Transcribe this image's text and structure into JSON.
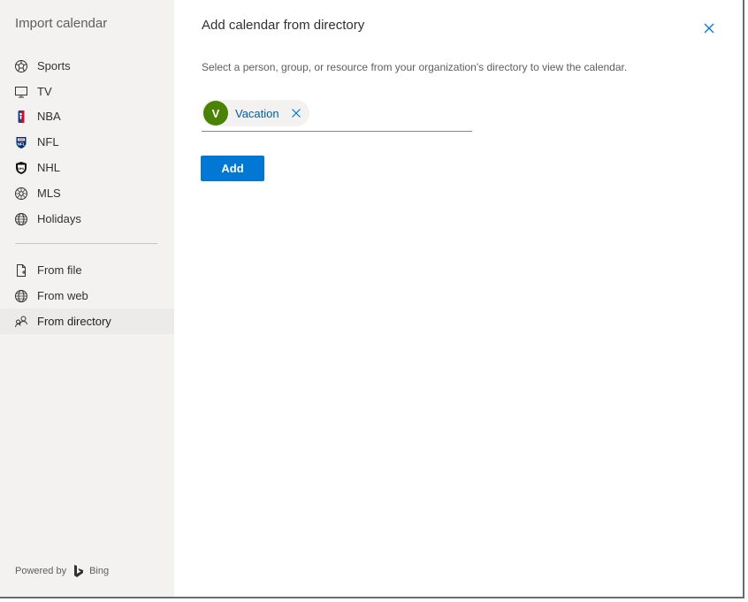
{
  "sidebar": {
    "title": "Import calendar",
    "sports": [
      {
        "label": "Sports",
        "icon": "soccer-ball-icon"
      },
      {
        "label": "TV",
        "icon": "tv-icon"
      },
      {
        "label": "NBA",
        "icon": "nba-logo-icon"
      },
      {
        "label": "NFL",
        "icon": "nfl-logo-icon"
      },
      {
        "label": "NHL",
        "icon": "nhl-logo-icon"
      },
      {
        "label": "MLS",
        "icon": "mls-ball-icon"
      },
      {
        "label": "Holidays",
        "icon": "globe-icon"
      }
    ],
    "sources": [
      {
        "label": "From file",
        "icon": "file-add-icon"
      },
      {
        "label": "From web",
        "icon": "globe-icon"
      },
      {
        "label": "From directory",
        "icon": "people-icon",
        "selected": true
      }
    ],
    "powered_by": "Powered by",
    "bing": "Bing"
  },
  "main": {
    "title": "Add calendar from directory",
    "description": "Select a person, group, or resource from your organization's directory to view the calendar.",
    "selected_persona": {
      "initial": "V",
      "name": "Vacation",
      "color": "#498205"
    },
    "add_button": "Add"
  },
  "colors": {
    "accent": "#0078d4",
    "sidebar_bg": "#f3f2f1",
    "link": "#005a9e"
  }
}
